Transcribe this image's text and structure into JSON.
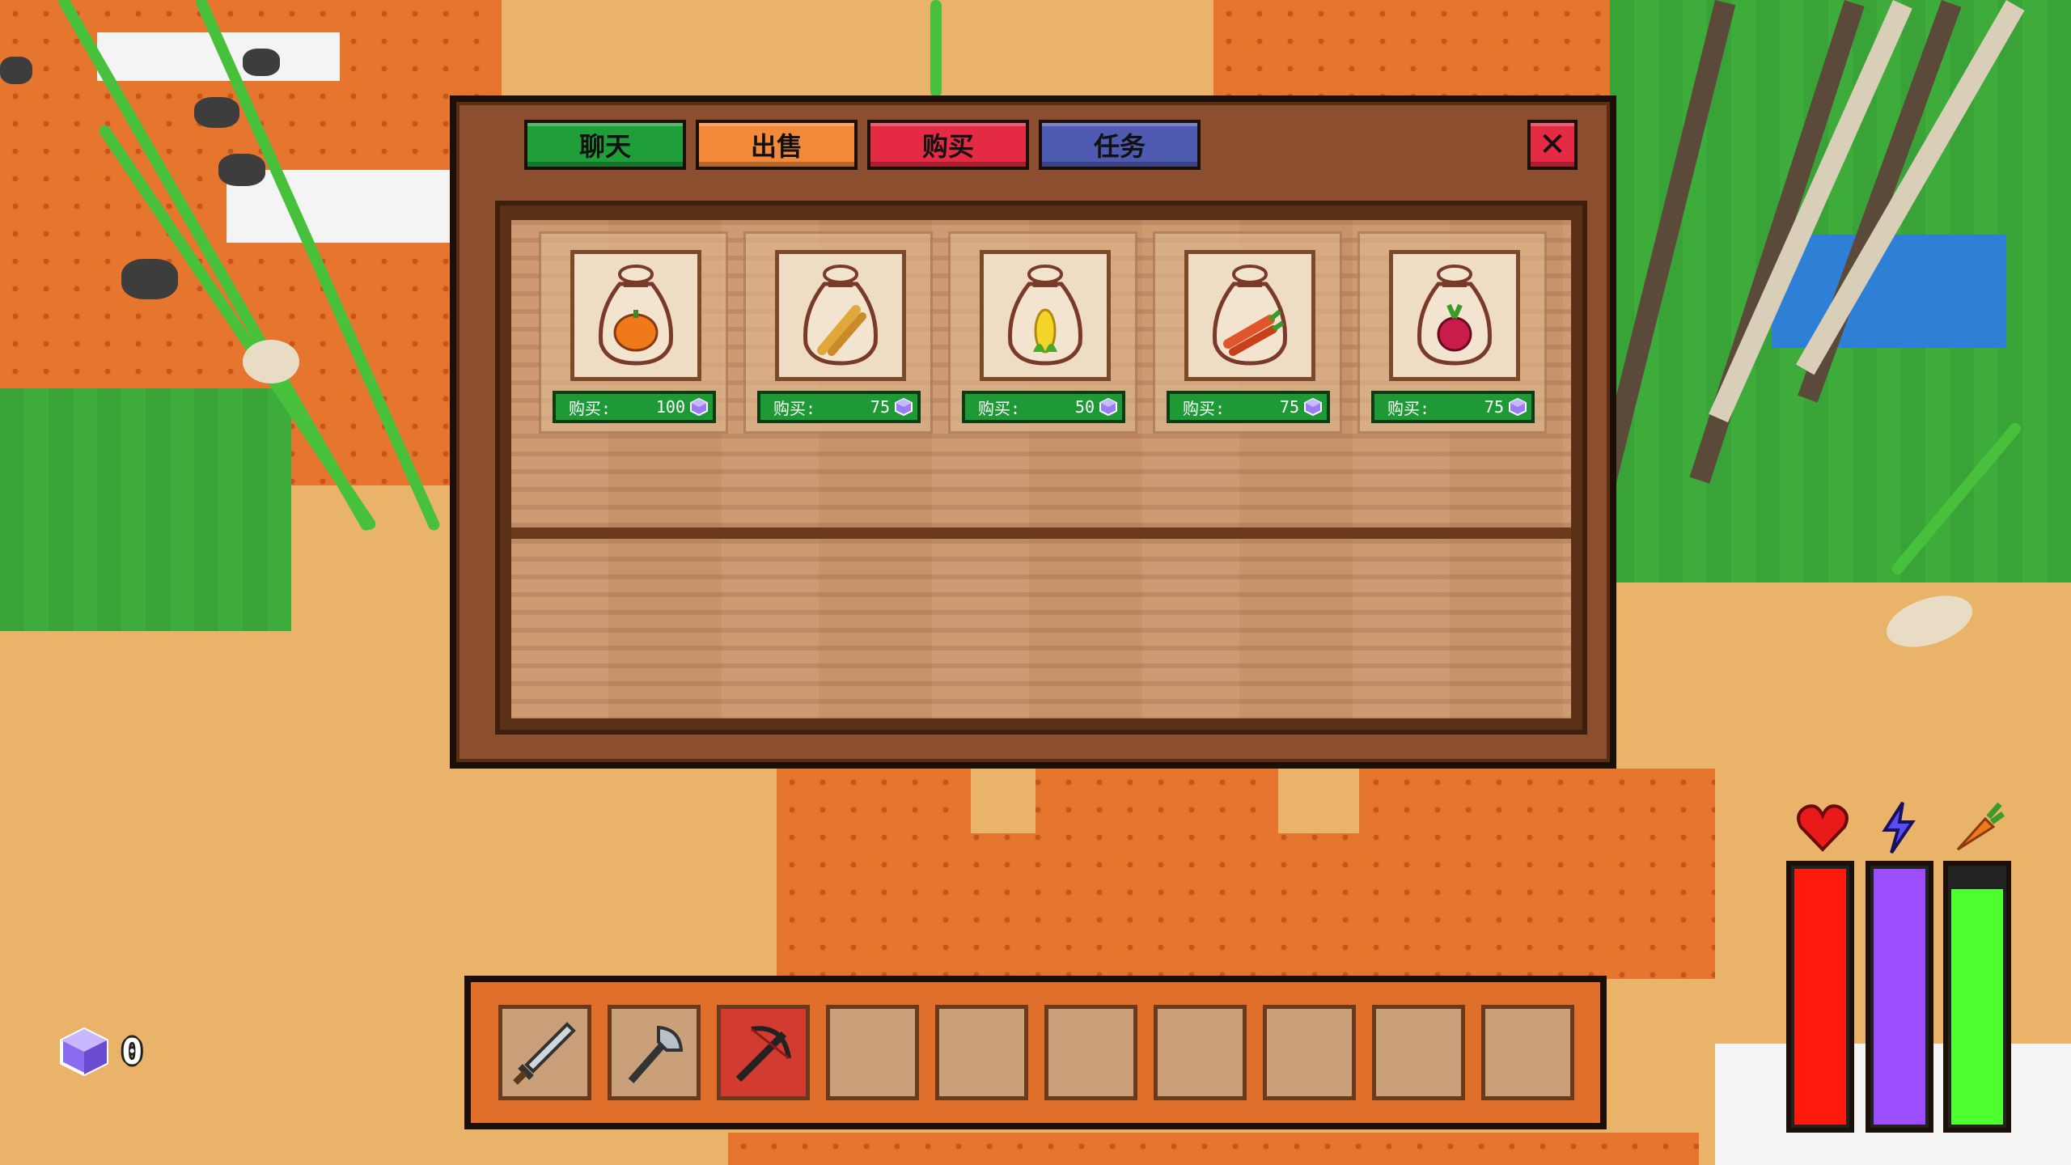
{
  "tabs": [
    {
      "label": "聊天",
      "color": "#1f9e3a"
    },
    {
      "label": "出售",
      "color": "#f28a3a"
    },
    {
      "label": "购买",
      "color": "#e52a44"
    },
    {
      "label": "任务",
      "color": "#4f5bb0"
    }
  ],
  "close": {
    "label": "✕",
    "color": "#e52a44"
  },
  "shop_items": [
    {
      "icon": "pumpkin-seed-bag-icon",
      "price_label": "购买:",
      "price": "100"
    },
    {
      "icon": "wheat-seed-bag-icon",
      "price_label": "购买:",
      "price": "75"
    },
    {
      "icon": "corn-seed-bag-icon",
      "price_label": "购买:",
      "price": "50"
    },
    {
      "icon": "carrot-seed-bag-icon",
      "price_label": "购买:",
      "price": "75"
    },
    {
      "icon": "beet-seed-bag-icon",
      "price_label": "购买:",
      "price": "75"
    }
  ],
  "hotbar": {
    "slots": [
      {
        "item": "sword-icon"
      },
      {
        "item": "axe-icon"
      },
      {
        "item": "crossbow-icon",
        "selected": true
      },
      {
        "item": ""
      },
      {
        "item": ""
      },
      {
        "item": ""
      },
      {
        "item": ""
      },
      {
        "item": ""
      },
      {
        "item": ""
      },
      {
        "item": ""
      }
    ]
  },
  "currency": {
    "icon": "gem-cube-icon",
    "count": "0"
  },
  "status": {
    "health": {
      "icon": "heart-icon",
      "fill": 1.0,
      "color": "#ff1a0d"
    },
    "energy": {
      "icon": "lightning-icon",
      "fill": 1.0,
      "color": "#9b4dff"
    },
    "hunger": {
      "icon": "carrot-icon",
      "fill": 0.92,
      "color": "#4dff2e"
    }
  }
}
